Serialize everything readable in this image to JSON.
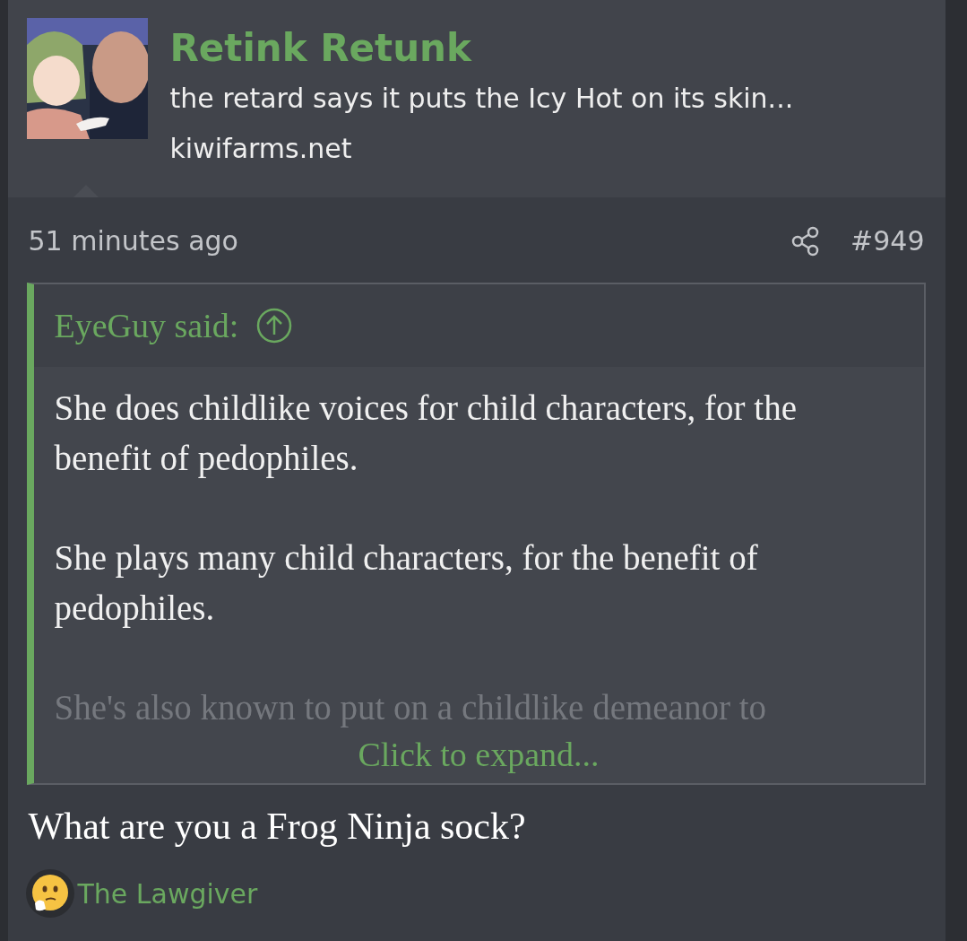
{
  "profile": {
    "username": "Retink Retunk",
    "tagline": "the retard says it puts the Icy Hot on its skin...",
    "domain": "kiwifarms.net"
  },
  "post": {
    "time": "51 minutes ago",
    "number": "#949",
    "quote": {
      "author": "EyeGuy said:",
      "paragraphs": [
        "She does childlike voices for child characters, for the benefit of pedophiles.",
        "She plays many child characters, for the benefit of pedophiles.",
        "She's also known to put on a childlike demeanor to"
      ],
      "expand_label": "Click to expand..."
    },
    "body": "What are you a Frog Ninja sock?",
    "reaction": {
      "label": "The Lawgiver"
    }
  }
}
